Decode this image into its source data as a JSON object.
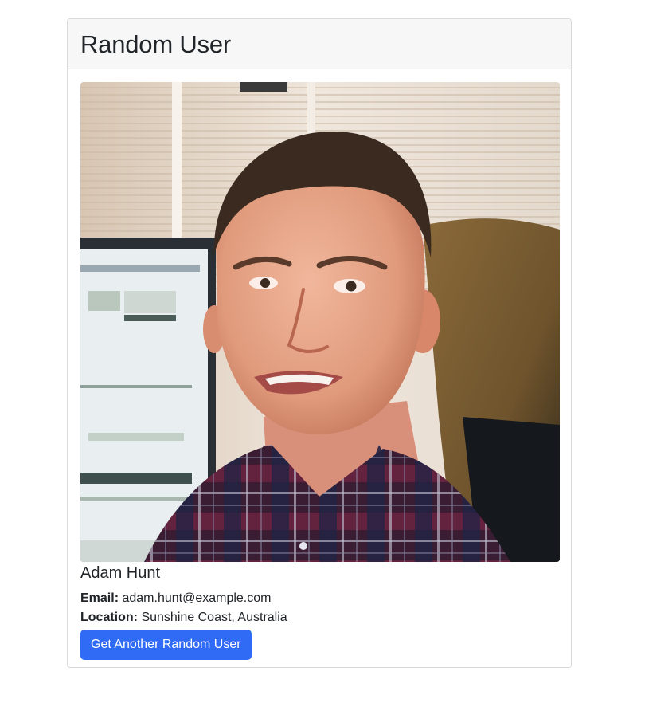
{
  "card": {
    "title": "Random User"
  },
  "user": {
    "name": "Adam Hunt",
    "photo_alt": "profile photo",
    "email_label": "Email:",
    "email": "adam.hunt@example.com",
    "location_label": "Location:",
    "location": "Sunshine Coast, Australia"
  },
  "actions": {
    "next_label": "Get Another Random User"
  },
  "colors": {
    "primary": "#2f6bf5",
    "header_bg": "#f7f7f7"
  }
}
